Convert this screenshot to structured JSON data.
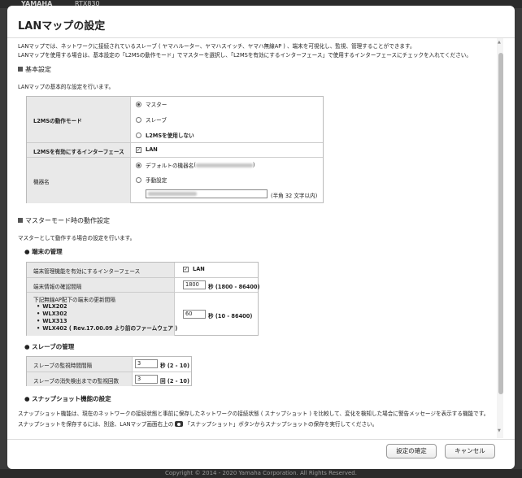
{
  "background": {
    "logo": "YAMAHA",
    "model": "RTX830",
    "footer": "Copyright © 2014 - 2020 Yamaha Corporation. All Rights Reserved."
  },
  "dialog": {
    "title": "LANマップの設定",
    "intro1": "LANマップでは、ネットワークに接続されているスレーブ ( ヤマハルーター、ヤマハスイッチ、ヤマハ無線AP ) 、端末を可視化し、監視、管理することができます。",
    "intro2": "LANマップを使用する場合は、基本設定の「L2MSの動作モード」でマスターを選択し、「L2MSを有効にするインターフェース」で使用するインターフェースにチェックを入れてください。"
  },
  "basic": {
    "heading": "基本設定",
    "desc": "LANマップの基本的な設定を行います。",
    "mode_label": "L2MSの動作モード",
    "mode_options": [
      "マスター",
      "スレーブ",
      "L2MSを使用しない"
    ],
    "iface_label": "L2MSを有効にするインターフェース",
    "iface_option": "LAN",
    "name_label": "機器名",
    "name_default": "デフォルトの機器名",
    "name_paren_open": "(",
    "name_paren_close": ")",
    "name_manual": "手動設定",
    "name_hint": "(半角 32 文字以内)"
  },
  "master": {
    "heading": "マスターモード時の動作設定",
    "desc": "マスターとして動作する場合の設定を行います。",
    "terminal_heading": "● 端末の管理",
    "term_iface_label": "端末管理機能を有効にするインターフェース",
    "term_iface_option": "LAN",
    "term_interval_label": "端末情報の確認間隔",
    "term_interval_value": "1800",
    "term_interval_unit": "秒 (1800 - 86400)",
    "ap_label": "下記無線AP配下の端末の更新間隔",
    "ap_models": [
      "WLX202",
      "WLX302",
      "WLX313",
      "WLX402 ( Rev.17.00.09 より前のファームウェア )"
    ],
    "ap_value": "60",
    "ap_unit": "秒 (10 - 86400)",
    "slave_heading": "● スレーブの管理",
    "slave_interval_label": "スレーブの監視時間間隔",
    "slave_interval_value": "3",
    "slave_interval_unit": "秒 (2 - 10)",
    "slave_count_label": "スレーブの消失検出までの監視回数",
    "slave_count_value": "3",
    "slave_count_unit": "回 (2 - 10)",
    "snapshot_heading": "● スナップショット機能の設定",
    "snapshot_desc1": "スナップショット機能は、現在のネットワークの接続状態と事前に保存したネットワークの接続状態 ( スナップショット ) を比較して、変化を検知した場合に警告メッセージを表示する機能です。",
    "snapshot_desc2a": "スナップショットを保存するには、別途、LANマップ画面右上の",
    "snapshot_desc2b": "「スナップショット」ボタンからスナップショットの保存を実行してください。"
  },
  "buttons": {
    "confirm": "設定の確定",
    "cancel": "キャンセル"
  },
  "icons": [
    "camera-icon",
    "radio-icon",
    "checkbox-icon",
    "scroll-arrow-icon"
  ]
}
